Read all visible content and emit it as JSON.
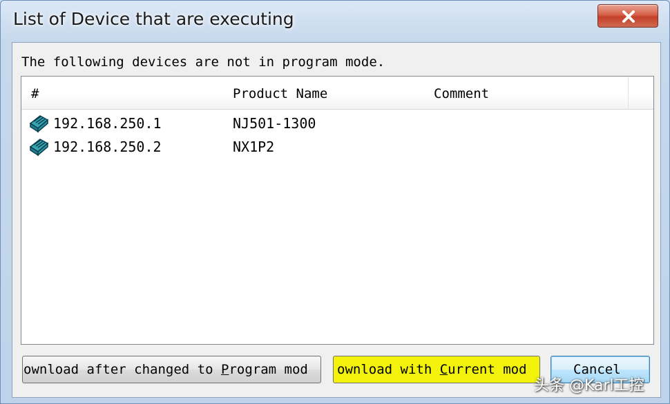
{
  "window": {
    "title": "List of Device that are executing"
  },
  "dialog": {
    "message": "The following devices are not in program mode."
  },
  "table": {
    "columns": [
      "#",
      "Product Name",
      "Comment"
    ],
    "rows": [
      {
        "address": "192.168.250.1",
        "product_name": "NJ501-1300",
        "comment": "",
        "icon": "plc-device-icon"
      },
      {
        "address": "192.168.250.2",
        "product_name": "NX1P2",
        "comment": "",
        "icon": "plc-device-icon"
      }
    ]
  },
  "buttons": {
    "program_mode": {
      "pre": "ownload after changed to ",
      "accel": "P",
      "post": "rogram mod"
    },
    "current_mode": {
      "pre": "ownload with ",
      "accel": "C",
      "post": "urrent mod",
      "highlight_color": "#f2f20a"
    },
    "cancel": {
      "label": "Cancel"
    }
  },
  "watermark": {
    "text": "头条 @Karl工控"
  }
}
